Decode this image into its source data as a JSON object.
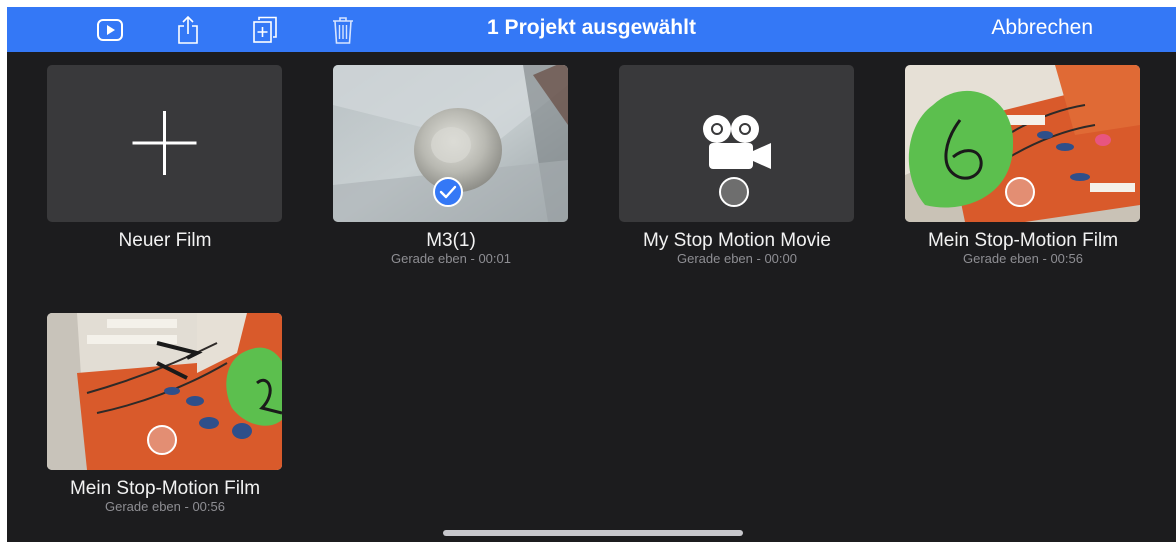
{
  "toolbar": {
    "title": "1 Projekt ausgewählt",
    "cancel_label": "Abbrechen",
    "background": "#3478f6",
    "icons": [
      "play-icon",
      "share-icon",
      "duplicate-icon",
      "trash-icon"
    ]
  },
  "projects": [
    {
      "title": "Neuer Film",
      "subtitle": ""
    },
    {
      "title": "M3(1)",
      "subtitle": "Gerade eben - 00:01",
      "selected": true
    },
    {
      "title": "My Stop Motion Movie",
      "subtitle": "Gerade eben - 00:00",
      "selected": false
    },
    {
      "title": "Mein Stop-Motion Film",
      "subtitle": "Gerade eben - 00:56",
      "selected": false
    },
    {
      "title": "Mein Stop-Motion Film",
      "subtitle": "Gerade eben - 00:56",
      "selected": false
    }
  ]
}
